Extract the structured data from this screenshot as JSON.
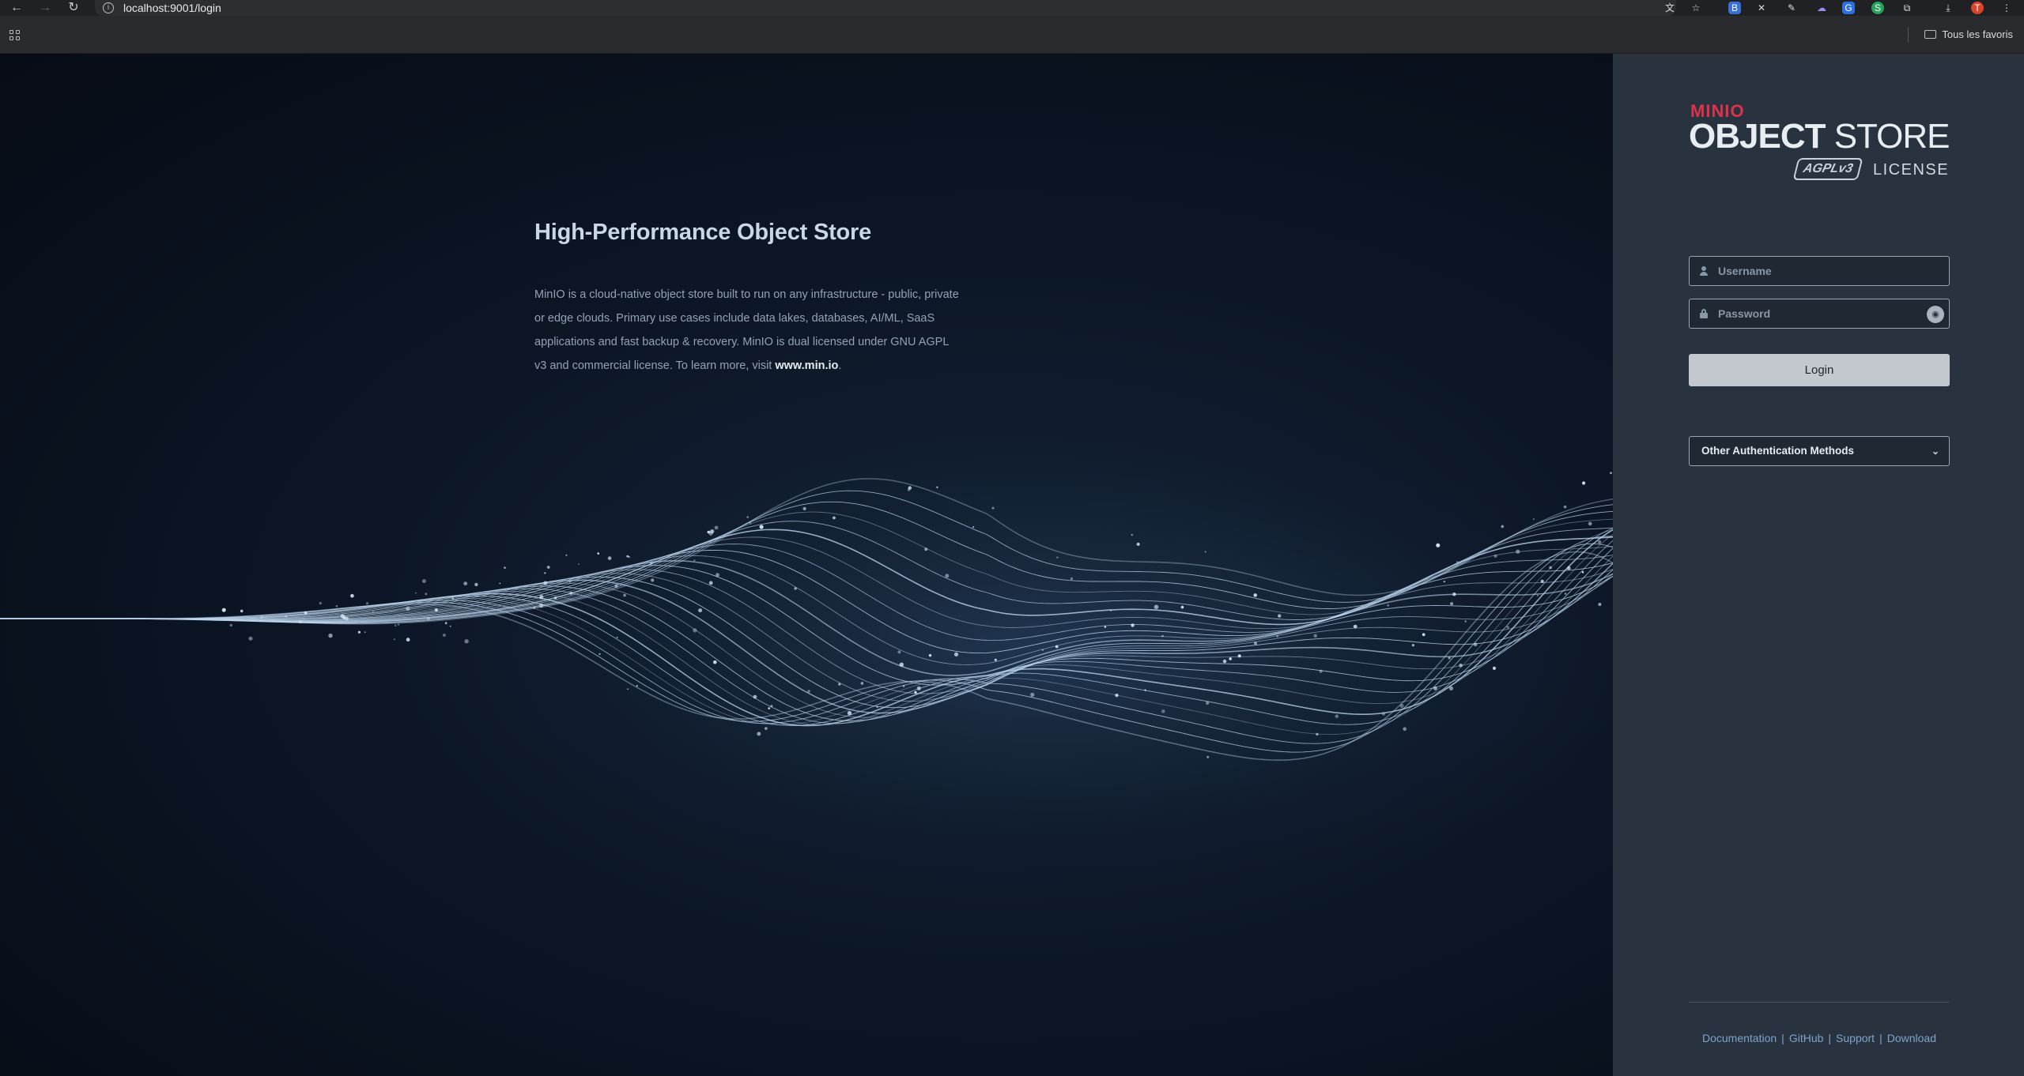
{
  "browser": {
    "url": "localhost:9001/login",
    "bookmarks_folder_label": "Tous les favoris",
    "profile_initial": "T"
  },
  "hero": {
    "title": "High-Performance Object Store",
    "description": "MinIO is a cloud-native object store built to run on any infrastructure - public, private or edge clouds. Primary use cases include data lakes, databases, AI/ML, SaaS applications and fast backup & recovery. MinIO is dual licensed under GNU AGPL v3 and commercial license. To learn more, visit",
    "link_text": "www.min.io",
    "link_suffix": "."
  },
  "logo": {
    "brand": "MINIO",
    "product_bold": "OBJECT",
    "product_light": " STORE",
    "badge": "AGPLv3",
    "license": "LICENSE"
  },
  "login": {
    "username_placeholder": "Username",
    "password_placeholder": "Password",
    "button_label": "Login",
    "other_methods_label": "Other Authentication Methods"
  },
  "footer": {
    "links": [
      "Documentation",
      "GitHub",
      "Support",
      "Download"
    ],
    "separator": "|"
  },
  "colors": {
    "brand_red": "#e0314b",
    "panel_bg": "#28333f",
    "hero_bg": "#0b1321",
    "link": "#7fa3cc"
  }
}
